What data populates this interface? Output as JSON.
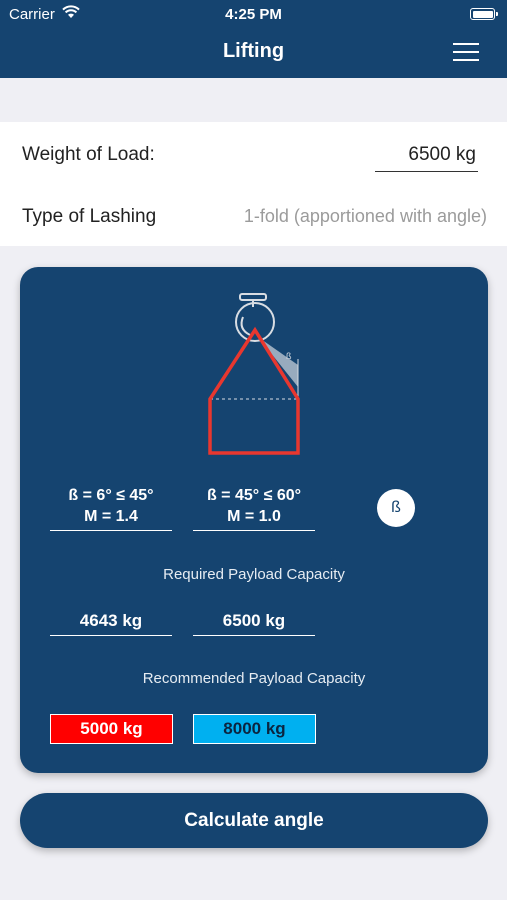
{
  "status_bar": {
    "carrier": "Carrier",
    "time": "4:25 PM"
  },
  "nav": {
    "title": "Lifting",
    "menu_icon": "hamburger-menu-icon"
  },
  "form": {
    "weight_label": "Weight of Load:",
    "weight_value": "6500  kg",
    "lashing_label": "Type of Lashing",
    "lashing_value": "1-fold (apportioned with angle)"
  },
  "card": {
    "columns": [
      {
        "angle": "ß = 6° ≤ 45°",
        "factor": "M = 1.4"
      },
      {
        "angle": "ß = 45° ≤ 60°",
        "factor": "M = 1.0"
      }
    ],
    "beta_button": "ß",
    "diagram_angle_label": "ß",
    "required_label": "Required Payload Capacity",
    "required_values": [
      "4643 kg",
      "6500 kg"
    ],
    "recommended_label": "Recommended Payload Capacity",
    "recommended_values": [
      "5000 kg",
      "8000 kg"
    ]
  },
  "calculate_button": "Calculate angle",
  "colors": {
    "primary": "#154470",
    "background": "#efeff4",
    "recommended_1": "#ff0000",
    "recommended_2": "#00b0f0",
    "sling": "#e8372f"
  }
}
